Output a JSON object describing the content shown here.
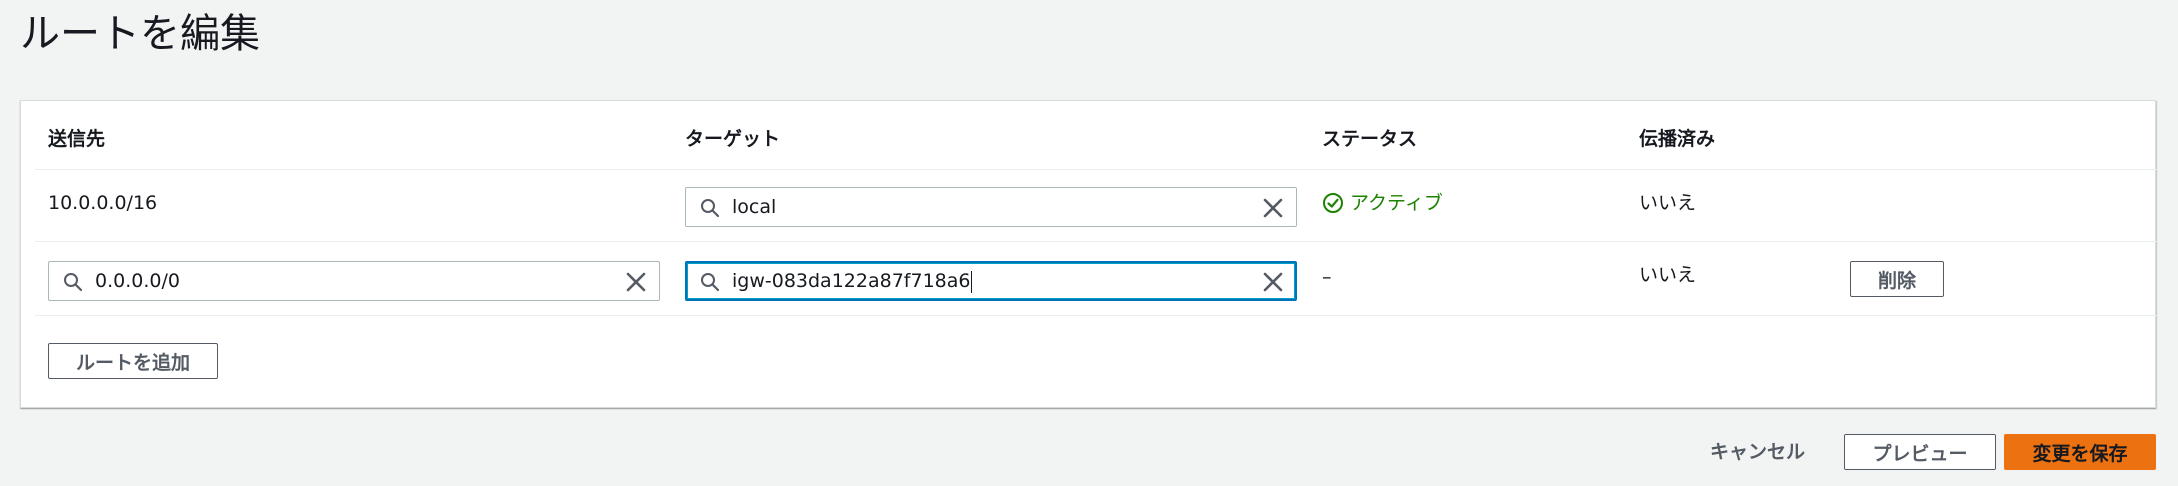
{
  "page": {
    "title": "ルートを編集"
  },
  "table": {
    "columns": [
      "送信先",
      "ターゲット",
      "ステータス",
      "伝播済み"
    ],
    "rows": [
      {
        "destination": "10.0.0.0/16",
        "target_value": "local",
        "status": "アクティブ",
        "propagated": "いいえ"
      },
      {
        "destination_value": "0.0.0.0/0",
        "target_value": "igw-083da122a87f718a6",
        "status": "–",
        "propagated": "いいえ",
        "delete_label": "削除"
      }
    ]
  },
  "add_route_label": "ルートを追加",
  "footer": {
    "cancel_label": "キャンセル",
    "preview_label": "プレビュー",
    "save_label": "変更を保存"
  },
  "colors": {
    "primary": "#ec7211",
    "status_active": "#1d8102",
    "focus": "#0073bb"
  },
  "icons": {
    "search": "search-icon",
    "clear": "clear-icon",
    "status": "check-circle-icon"
  }
}
